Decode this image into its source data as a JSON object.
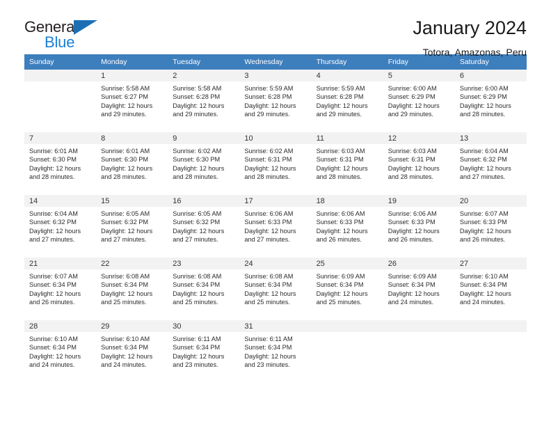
{
  "brand": {
    "name_dark": "General",
    "name_blue": "Blue",
    "accent_color": "#1c7fd4",
    "header_color": "#3d7ebd"
  },
  "header": {
    "title": "January 2024",
    "subtitle": "Totora, Amazonas, Peru"
  },
  "weekdays": [
    "Sunday",
    "Monday",
    "Tuesday",
    "Wednesday",
    "Thursday",
    "Friday",
    "Saturday"
  ],
  "weeks": [
    [
      {
        "day": "",
        "sunrise": "",
        "sunset": "",
        "daylight": "",
        "empty": true
      },
      {
        "day": "1",
        "sunrise": "Sunrise: 5:58 AM",
        "sunset": "Sunset: 6:27 PM",
        "daylight": "Daylight: 12 hours and 29 minutes."
      },
      {
        "day": "2",
        "sunrise": "Sunrise: 5:58 AM",
        "sunset": "Sunset: 6:28 PM",
        "daylight": "Daylight: 12 hours and 29 minutes."
      },
      {
        "day": "3",
        "sunrise": "Sunrise: 5:59 AM",
        "sunset": "Sunset: 6:28 PM",
        "daylight": "Daylight: 12 hours and 29 minutes."
      },
      {
        "day": "4",
        "sunrise": "Sunrise: 5:59 AM",
        "sunset": "Sunset: 6:28 PM",
        "daylight": "Daylight: 12 hours and 29 minutes."
      },
      {
        "day": "5",
        "sunrise": "Sunrise: 6:00 AM",
        "sunset": "Sunset: 6:29 PM",
        "daylight": "Daylight: 12 hours and 29 minutes."
      },
      {
        "day": "6",
        "sunrise": "Sunrise: 6:00 AM",
        "sunset": "Sunset: 6:29 PM",
        "daylight": "Daylight: 12 hours and 28 minutes."
      }
    ],
    [
      {
        "day": "7",
        "sunrise": "Sunrise: 6:01 AM",
        "sunset": "Sunset: 6:30 PM",
        "daylight": "Daylight: 12 hours and 28 minutes."
      },
      {
        "day": "8",
        "sunrise": "Sunrise: 6:01 AM",
        "sunset": "Sunset: 6:30 PM",
        "daylight": "Daylight: 12 hours and 28 minutes."
      },
      {
        "day": "9",
        "sunrise": "Sunrise: 6:02 AM",
        "sunset": "Sunset: 6:30 PM",
        "daylight": "Daylight: 12 hours and 28 minutes."
      },
      {
        "day": "10",
        "sunrise": "Sunrise: 6:02 AM",
        "sunset": "Sunset: 6:31 PM",
        "daylight": "Daylight: 12 hours and 28 minutes."
      },
      {
        "day": "11",
        "sunrise": "Sunrise: 6:03 AM",
        "sunset": "Sunset: 6:31 PM",
        "daylight": "Daylight: 12 hours and 28 minutes."
      },
      {
        "day": "12",
        "sunrise": "Sunrise: 6:03 AM",
        "sunset": "Sunset: 6:31 PM",
        "daylight": "Daylight: 12 hours and 28 minutes."
      },
      {
        "day": "13",
        "sunrise": "Sunrise: 6:04 AM",
        "sunset": "Sunset: 6:32 PM",
        "daylight": "Daylight: 12 hours and 27 minutes."
      }
    ],
    [
      {
        "day": "14",
        "sunrise": "Sunrise: 6:04 AM",
        "sunset": "Sunset: 6:32 PM",
        "daylight": "Daylight: 12 hours and 27 minutes."
      },
      {
        "day": "15",
        "sunrise": "Sunrise: 6:05 AM",
        "sunset": "Sunset: 6:32 PM",
        "daylight": "Daylight: 12 hours and 27 minutes."
      },
      {
        "day": "16",
        "sunrise": "Sunrise: 6:05 AM",
        "sunset": "Sunset: 6:32 PM",
        "daylight": "Daylight: 12 hours and 27 minutes."
      },
      {
        "day": "17",
        "sunrise": "Sunrise: 6:06 AM",
        "sunset": "Sunset: 6:33 PM",
        "daylight": "Daylight: 12 hours and 27 minutes."
      },
      {
        "day": "18",
        "sunrise": "Sunrise: 6:06 AM",
        "sunset": "Sunset: 6:33 PM",
        "daylight": "Daylight: 12 hours and 26 minutes."
      },
      {
        "day": "19",
        "sunrise": "Sunrise: 6:06 AM",
        "sunset": "Sunset: 6:33 PM",
        "daylight": "Daylight: 12 hours and 26 minutes."
      },
      {
        "day": "20",
        "sunrise": "Sunrise: 6:07 AM",
        "sunset": "Sunset: 6:33 PM",
        "daylight": "Daylight: 12 hours and 26 minutes."
      }
    ],
    [
      {
        "day": "21",
        "sunrise": "Sunrise: 6:07 AM",
        "sunset": "Sunset: 6:34 PM",
        "daylight": "Daylight: 12 hours and 26 minutes."
      },
      {
        "day": "22",
        "sunrise": "Sunrise: 6:08 AM",
        "sunset": "Sunset: 6:34 PM",
        "daylight": "Daylight: 12 hours and 25 minutes."
      },
      {
        "day": "23",
        "sunrise": "Sunrise: 6:08 AM",
        "sunset": "Sunset: 6:34 PM",
        "daylight": "Daylight: 12 hours and 25 minutes."
      },
      {
        "day": "24",
        "sunrise": "Sunrise: 6:08 AM",
        "sunset": "Sunset: 6:34 PM",
        "daylight": "Daylight: 12 hours and 25 minutes."
      },
      {
        "day": "25",
        "sunrise": "Sunrise: 6:09 AM",
        "sunset": "Sunset: 6:34 PM",
        "daylight": "Daylight: 12 hours and 25 minutes."
      },
      {
        "day": "26",
        "sunrise": "Sunrise: 6:09 AM",
        "sunset": "Sunset: 6:34 PM",
        "daylight": "Daylight: 12 hours and 24 minutes."
      },
      {
        "day": "27",
        "sunrise": "Sunrise: 6:10 AM",
        "sunset": "Sunset: 6:34 PM",
        "daylight": "Daylight: 12 hours and 24 minutes."
      }
    ],
    [
      {
        "day": "28",
        "sunrise": "Sunrise: 6:10 AM",
        "sunset": "Sunset: 6:34 PM",
        "daylight": "Daylight: 12 hours and 24 minutes."
      },
      {
        "day": "29",
        "sunrise": "Sunrise: 6:10 AM",
        "sunset": "Sunset: 6:34 PM",
        "daylight": "Daylight: 12 hours and 24 minutes."
      },
      {
        "day": "30",
        "sunrise": "Sunrise: 6:11 AM",
        "sunset": "Sunset: 6:34 PM",
        "daylight": "Daylight: 12 hours and 23 minutes."
      },
      {
        "day": "31",
        "sunrise": "Sunrise: 6:11 AM",
        "sunset": "Sunset: 6:34 PM",
        "daylight": "Daylight: 12 hours and 23 minutes."
      },
      {
        "day": "",
        "sunrise": "",
        "sunset": "",
        "daylight": "",
        "void": true
      },
      {
        "day": "",
        "sunrise": "",
        "sunset": "",
        "daylight": "",
        "void": true
      },
      {
        "day": "",
        "sunrise": "",
        "sunset": "",
        "daylight": "",
        "void": true
      }
    ]
  ]
}
